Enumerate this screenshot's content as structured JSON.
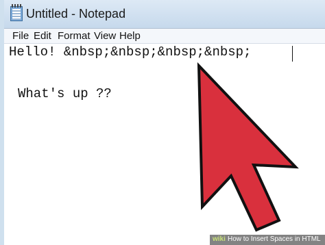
{
  "window": {
    "title": "Untitled - Notepad",
    "icon": "notepad-icon"
  },
  "menu": {
    "items": [
      {
        "label": "File"
      },
      {
        "label": "Edit"
      },
      {
        "label": "Format"
      },
      {
        "label": "View"
      },
      {
        "label": "Help"
      }
    ]
  },
  "editor": {
    "lines": [
      "Hello! &nbsp;&nbsp;&nbsp;&nbsp; ",
      "What's up ??"
    ]
  },
  "annotation": {
    "pointer": "red-arrow-pointer",
    "color": "#d9303d"
  },
  "watermark": {
    "logo": "wiki",
    "text": "How to Insert Spaces in HTML"
  }
}
